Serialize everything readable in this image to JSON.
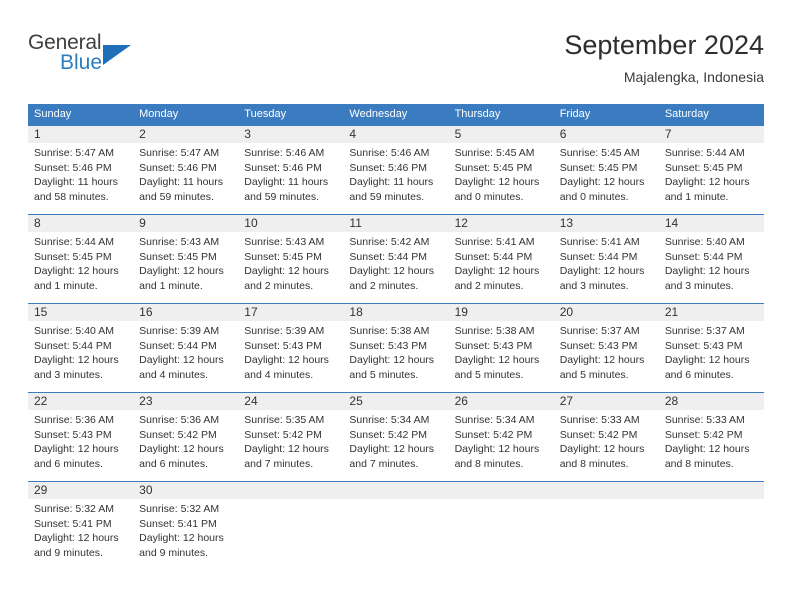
{
  "logo": {
    "word_top": "General",
    "word_bottom": "Blue",
    "triangle_color": "#1f6fb8",
    "blue_text_color": "#2a7ec0",
    "icon": "general-blue-logo"
  },
  "header": {
    "title": "September 2024",
    "subtitle": "Majalengka, Indonesia"
  },
  "theme": {
    "header_blue": "#3b7cc0",
    "daynum_band": "#efefef",
    "text": "#333333",
    "background": "#ffffff"
  },
  "calendar": {
    "weekdays": [
      "Sunday",
      "Monday",
      "Tuesday",
      "Wednesday",
      "Thursday",
      "Friday",
      "Saturday"
    ],
    "weeks": [
      [
        {
          "day": "1",
          "sunrise": "Sunrise: 5:47 AM",
          "sunset": "Sunset: 5:46 PM",
          "daylight1": "Daylight: 11 hours",
          "daylight2": "and 58 minutes."
        },
        {
          "day": "2",
          "sunrise": "Sunrise: 5:47 AM",
          "sunset": "Sunset: 5:46 PM",
          "daylight1": "Daylight: 11 hours",
          "daylight2": "and 59 minutes."
        },
        {
          "day": "3",
          "sunrise": "Sunrise: 5:46 AM",
          "sunset": "Sunset: 5:46 PM",
          "daylight1": "Daylight: 11 hours",
          "daylight2": "and 59 minutes."
        },
        {
          "day": "4",
          "sunrise": "Sunrise: 5:46 AM",
          "sunset": "Sunset: 5:46 PM",
          "daylight1": "Daylight: 11 hours",
          "daylight2": "and 59 minutes."
        },
        {
          "day": "5",
          "sunrise": "Sunrise: 5:45 AM",
          "sunset": "Sunset: 5:45 PM",
          "daylight1": "Daylight: 12 hours",
          "daylight2": "and 0 minutes."
        },
        {
          "day": "6",
          "sunrise": "Sunrise: 5:45 AM",
          "sunset": "Sunset: 5:45 PM",
          "daylight1": "Daylight: 12 hours",
          "daylight2": "and 0 minutes."
        },
        {
          "day": "7",
          "sunrise": "Sunrise: 5:44 AM",
          "sunset": "Sunset: 5:45 PM",
          "daylight1": "Daylight: 12 hours",
          "daylight2": "and 1 minute."
        }
      ],
      [
        {
          "day": "8",
          "sunrise": "Sunrise: 5:44 AM",
          "sunset": "Sunset: 5:45 PM",
          "daylight1": "Daylight: 12 hours",
          "daylight2": "and 1 minute."
        },
        {
          "day": "9",
          "sunrise": "Sunrise: 5:43 AM",
          "sunset": "Sunset: 5:45 PM",
          "daylight1": "Daylight: 12 hours",
          "daylight2": "and 1 minute."
        },
        {
          "day": "10",
          "sunrise": "Sunrise: 5:43 AM",
          "sunset": "Sunset: 5:45 PM",
          "daylight1": "Daylight: 12 hours",
          "daylight2": "and 2 minutes."
        },
        {
          "day": "11",
          "sunrise": "Sunrise: 5:42 AM",
          "sunset": "Sunset: 5:44 PM",
          "daylight1": "Daylight: 12 hours",
          "daylight2": "and 2 minutes."
        },
        {
          "day": "12",
          "sunrise": "Sunrise: 5:41 AM",
          "sunset": "Sunset: 5:44 PM",
          "daylight1": "Daylight: 12 hours",
          "daylight2": "and 2 minutes."
        },
        {
          "day": "13",
          "sunrise": "Sunrise: 5:41 AM",
          "sunset": "Sunset: 5:44 PM",
          "daylight1": "Daylight: 12 hours",
          "daylight2": "and 3 minutes."
        },
        {
          "day": "14",
          "sunrise": "Sunrise: 5:40 AM",
          "sunset": "Sunset: 5:44 PM",
          "daylight1": "Daylight: 12 hours",
          "daylight2": "and 3 minutes."
        }
      ],
      [
        {
          "day": "15",
          "sunrise": "Sunrise: 5:40 AM",
          "sunset": "Sunset: 5:44 PM",
          "daylight1": "Daylight: 12 hours",
          "daylight2": "and 3 minutes."
        },
        {
          "day": "16",
          "sunrise": "Sunrise: 5:39 AM",
          "sunset": "Sunset: 5:44 PM",
          "daylight1": "Daylight: 12 hours",
          "daylight2": "and 4 minutes."
        },
        {
          "day": "17",
          "sunrise": "Sunrise: 5:39 AM",
          "sunset": "Sunset: 5:43 PM",
          "daylight1": "Daylight: 12 hours",
          "daylight2": "and 4 minutes."
        },
        {
          "day": "18",
          "sunrise": "Sunrise: 5:38 AM",
          "sunset": "Sunset: 5:43 PM",
          "daylight1": "Daylight: 12 hours",
          "daylight2": "and 5 minutes."
        },
        {
          "day": "19",
          "sunrise": "Sunrise: 5:38 AM",
          "sunset": "Sunset: 5:43 PM",
          "daylight1": "Daylight: 12 hours",
          "daylight2": "and 5 minutes."
        },
        {
          "day": "20",
          "sunrise": "Sunrise: 5:37 AM",
          "sunset": "Sunset: 5:43 PM",
          "daylight1": "Daylight: 12 hours",
          "daylight2": "and 5 minutes."
        },
        {
          "day": "21",
          "sunrise": "Sunrise: 5:37 AM",
          "sunset": "Sunset: 5:43 PM",
          "daylight1": "Daylight: 12 hours",
          "daylight2": "and 6 minutes."
        }
      ],
      [
        {
          "day": "22",
          "sunrise": "Sunrise: 5:36 AM",
          "sunset": "Sunset: 5:43 PM",
          "daylight1": "Daylight: 12 hours",
          "daylight2": "and 6 minutes."
        },
        {
          "day": "23",
          "sunrise": "Sunrise: 5:36 AM",
          "sunset": "Sunset: 5:42 PM",
          "daylight1": "Daylight: 12 hours",
          "daylight2": "and 6 minutes."
        },
        {
          "day": "24",
          "sunrise": "Sunrise: 5:35 AM",
          "sunset": "Sunset: 5:42 PM",
          "daylight1": "Daylight: 12 hours",
          "daylight2": "and 7 minutes."
        },
        {
          "day": "25",
          "sunrise": "Sunrise: 5:34 AM",
          "sunset": "Sunset: 5:42 PM",
          "daylight1": "Daylight: 12 hours",
          "daylight2": "and 7 minutes."
        },
        {
          "day": "26",
          "sunrise": "Sunrise: 5:34 AM",
          "sunset": "Sunset: 5:42 PM",
          "daylight1": "Daylight: 12 hours",
          "daylight2": "and 8 minutes."
        },
        {
          "day": "27",
          "sunrise": "Sunrise: 5:33 AM",
          "sunset": "Sunset: 5:42 PM",
          "daylight1": "Daylight: 12 hours",
          "daylight2": "and 8 minutes."
        },
        {
          "day": "28",
          "sunrise": "Sunrise: 5:33 AM",
          "sunset": "Sunset: 5:42 PM",
          "daylight1": "Daylight: 12 hours",
          "daylight2": "and 8 minutes."
        }
      ],
      [
        {
          "day": "29",
          "sunrise": "Sunrise: 5:32 AM",
          "sunset": "Sunset: 5:41 PM",
          "daylight1": "Daylight: 12 hours",
          "daylight2": "and 9 minutes."
        },
        {
          "day": "30",
          "sunrise": "Sunrise: 5:32 AM",
          "sunset": "Sunset: 5:41 PM",
          "daylight1": "Daylight: 12 hours",
          "daylight2": "and 9 minutes."
        },
        {
          "day": "",
          "sunrise": "",
          "sunset": "",
          "daylight1": "",
          "daylight2": ""
        },
        {
          "day": "",
          "sunrise": "",
          "sunset": "",
          "daylight1": "",
          "daylight2": ""
        },
        {
          "day": "",
          "sunrise": "",
          "sunset": "",
          "daylight1": "",
          "daylight2": ""
        },
        {
          "day": "",
          "sunrise": "",
          "sunset": "",
          "daylight1": "",
          "daylight2": ""
        },
        {
          "day": "",
          "sunrise": "",
          "sunset": "",
          "daylight1": "",
          "daylight2": ""
        }
      ]
    ]
  }
}
